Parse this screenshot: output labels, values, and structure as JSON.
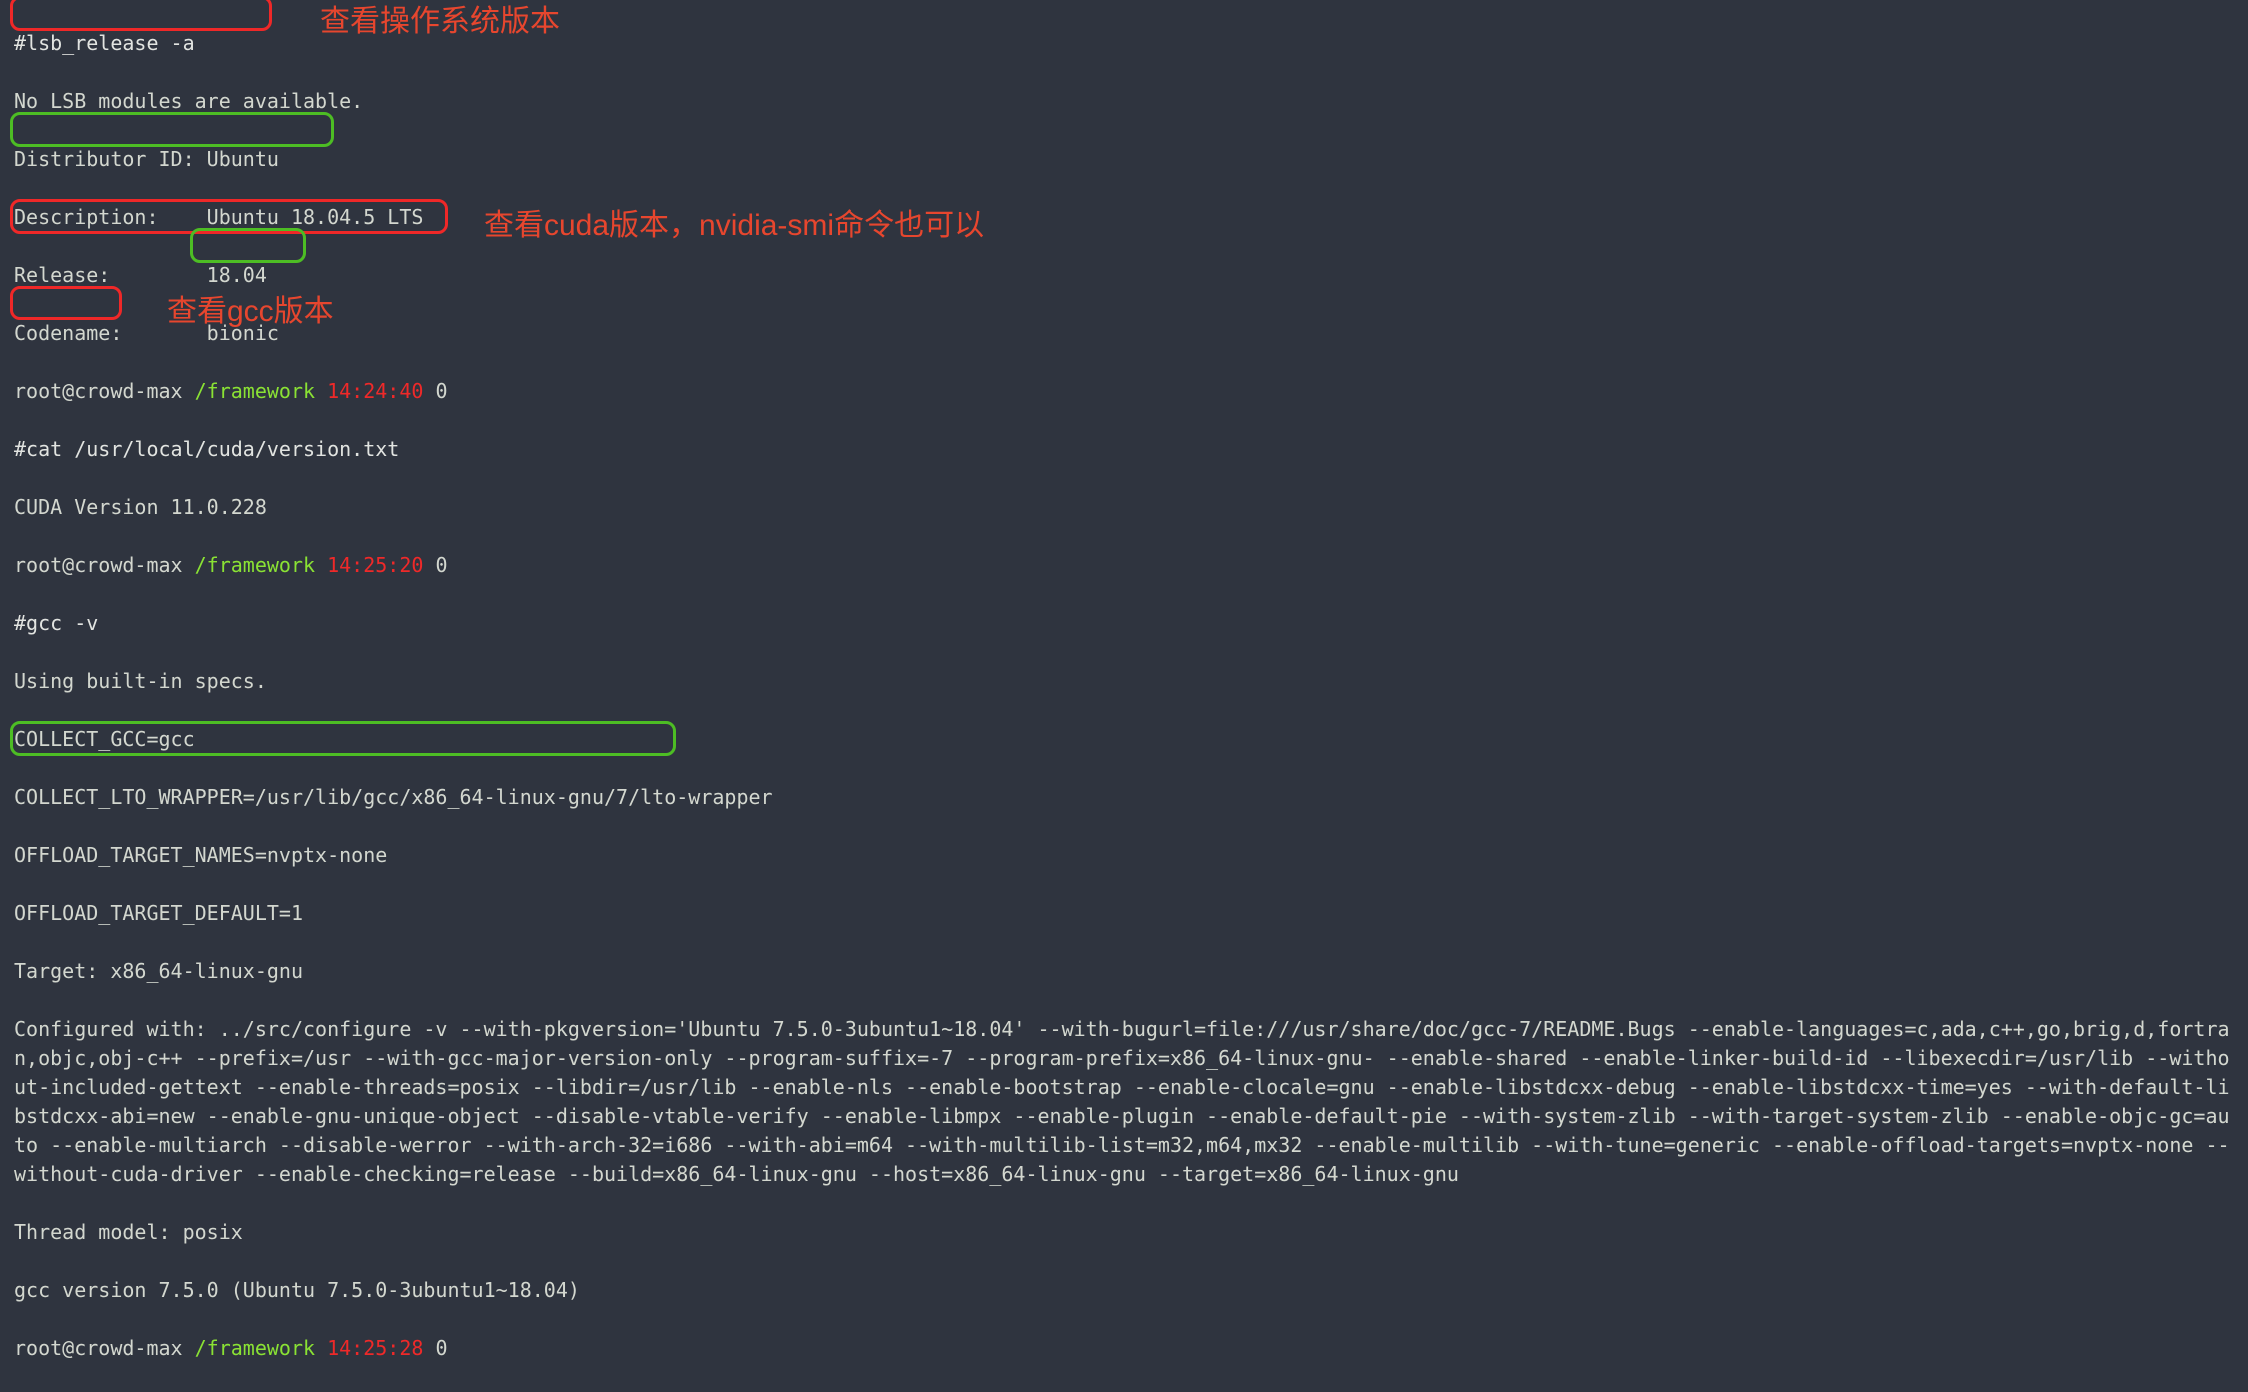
{
  "prompt_user": "root@crowd-max",
  "prompt_path": "/framework",
  "cmds": {
    "lsb": "#lsb_release -a",
    "cat": "#cat /usr/local/cuda/version.txt",
    "gcc": "#gcc -v"
  },
  "times": {
    "t1": "14:24:40",
    "t2": "14:25:20",
    "t3": "14:25:28"
  },
  "zero": "0",
  "lsb_output": {
    "no_modules": "No LSB modules are available.",
    "distributor": "Distributor ID: Ubuntu",
    "description": "Description:    Ubuntu 18.04.5 LTS",
    "release": "Release:        18.04",
    "codename": "Codename:       bionic"
  },
  "cuda_output": "CUDA Version 11.0.228",
  "gcc_output": {
    "using": "Using built-in specs.",
    "collect_gcc": "COLLECT_GCC=gcc",
    "collect_lto": "COLLECT_LTO_WRAPPER=/usr/lib/gcc/x86_64-linux-gnu/7/lto-wrapper",
    "offload_names": "OFFLOAD_TARGET_NAMES=nvptx-none",
    "offload_default": "OFFLOAD_TARGET_DEFAULT=1",
    "target": "Target: x86_64-linux-gnu",
    "configured": "Configured with: ../src/configure -v --with-pkgversion='Ubuntu 7.5.0-3ubuntu1~18.04' --with-bugurl=file:///usr/share/doc/gcc-7/README.Bugs --enable-languages=c,ada,c++,go,brig,d,fortran,objc,obj-c++ --prefix=/usr --with-gcc-major-version-only --program-suffix=-7 --program-prefix=x86_64-linux-gnu- --enable-shared --enable-linker-build-id --libexecdir=/usr/lib --without-included-gettext --enable-threads=posix --libdir=/usr/lib --enable-nls --enable-bootstrap --enable-clocale=gnu --enable-libstdcxx-debug --enable-libstdcxx-time=yes --with-default-libstdcxx-abi=new --enable-gnu-unique-object --disable-vtable-verify --enable-libmpx --enable-plugin --enable-default-pie --with-system-zlib --with-target-system-zlib --enable-objc-gc=auto --enable-multiarch --disable-werror --with-arch-32=i686 --with-abi=m64 --with-multilib-list=m32,m64,mx32 --enable-multilib --with-tune=generic --enable-offload-targets=nvptx-none --without-cuda-driver --enable-checking=release --build=x86_64-linux-gnu --host=x86_64-linux-gnu --target=x86_64-linux-gnu",
    "thread_model": "Thread model: posix",
    "version": "gcc version 7.5.0 (Ubuntu 7.5.0-3ubuntu1~18.04) "
  },
  "annotations": {
    "os": "查看操作系统版本",
    "cuda": "查看cuda版本，nvidia-smi命令也可以",
    "gcc": "查看gcc版本"
  },
  "space": " ",
  "chart_data": null
}
